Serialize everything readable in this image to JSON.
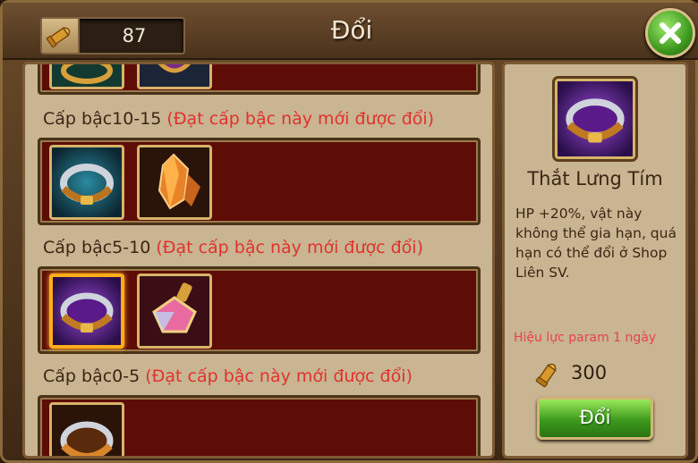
{
  "header": {
    "title": "Đổi",
    "currency_icon": "bullet-icon",
    "currency_value": "87",
    "close_icon": "close-x-icon"
  },
  "tiers": [
    {
      "label": "Cấp bậc10-15",
      "requirement": "(Đạt cấp bậc này mới được đổi)",
      "items": [
        {
          "name": "cyan-belt-icon"
        },
        {
          "name": "orange-crystal-icon"
        }
      ]
    },
    {
      "label": "Cấp bậc5-10",
      "requirement": "(Đạt cấp bậc này mới được đổi)",
      "items": [
        {
          "name": "purple-belt-icon",
          "selected": true
        },
        {
          "name": "potion-gem-icon"
        }
      ]
    },
    {
      "label": "Cấp bậc0-5",
      "requirement": "(Đạt cấp bậc này mới được đổi)",
      "items": [
        {
          "name": "orange-belt-icon"
        }
      ]
    }
  ],
  "detail": {
    "item_icon": "purple-belt-icon",
    "name": "Thắt Lưng Tím",
    "description": "HP +20%, vật này không thể gia hạn, quá hạn có thể đổi ở Shop Liên SV.",
    "validity": "Hiệu lực param 1 ngày",
    "price_icon": "bullet-icon",
    "price": "300",
    "button_label": "Đổi"
  },
  "colors": {
    "requirement_text": "#e0322e",
    "row_background": "#5e0c06",
    "selected_border": "#ffae1a",
    "button_green": "#3d9a1e"
  }
}
